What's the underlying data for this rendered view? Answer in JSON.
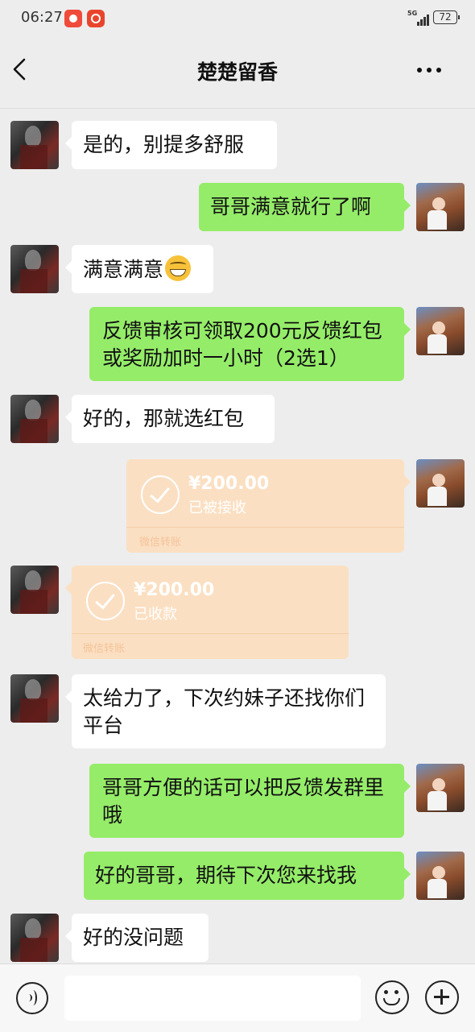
{
  "status_bar": {
    "time": "06:27",
    "network": "5G",
    "battery": "72"
  },
  "header": {
    "title": "楚楚留香"
  },
  "messages": [
    {
      "from": "other",
      "text": "是的，别提多舒服"
    },
    {
      "from": "me",
      "text": "哥哥满意就行了啊"
    },
    {
      "from": "other",
      "text": "满意满意",
      "emoji": "grinning-emoji"
    },
    {
      "from": "me",
      "text": "反馈审核可领取200元反馈红包或奖励加时一小时（2选1）"
    },
    {
      "from": "other",
      "text": "好的，那就选红包"
    },
    {
      "from": "me",
      "type": "transfer",
      "amount": "¥200.00",
      "status": "已被接收",
      "label": "微信转账"
    },
    {
      "from": "other",
      "type": "transfer",
      "amount": "¥200.00",
      "status": "已收款",
      "label": "微信转账"
    },
    {
      "from": "other",
      "text": "太给力了，下次约妹子还找你们平台"
    },
    {
      "from": "me",
      "text": "哥哥方便的话可以把反馈发群里哦"
    },
    {
      "from": "me",
      "text": "好的哥哥，期待下次您来找我"
    },
    {
      "from": "other",
      "text": "好的没问题"
    }
  ],
  "input_bar": {
    "placeholder": "",
    "value": ""
  },
  "icons": {
    "back": "back-arrow-icon",
    "more": "more-dots-icon",
    "voice": "voice-icon",
    "emoji": "emoji-icon",
    "plus": "plus-icon",
    "transfer": "check-circle-icon"
  },
  "colors": {
    "background": "#ededed",
    "my_bubble": "#95ec69",
    "their_bubble": "#ffffff",
    "transfer": "#fbdfc2"
  }
}
